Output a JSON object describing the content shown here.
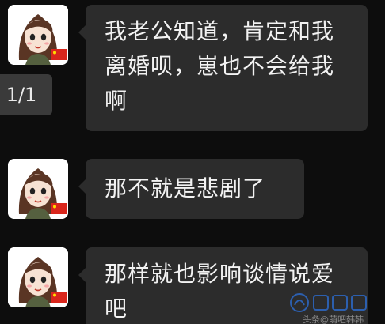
{
  "page_counter": "1/1",
  "messages": [
    {
      "sender": "contact",
      "text": "我老公知道，肯定和我离婚呗，崽也不会给我啊"
    },
    {
      "sender": "contact",
      "text": "那不就是悲剧了"
    },
    {
      "sender": "contact",
      "text": "那样就也影响谈情说爱吧"
    }
  ],
  "watermark": {
    "text": "头条@萌吧韩韩",
    "logo": "site-logo"
  },
  "colors": {
    "background": "#0d0d0d",
    "bubble": "#2c2c2c",
    "bubble_text": "#f2f2f2",
    "counter_bg": "#3a3a3a",
    "flag_red": "#d9261c"
  },
  "icons": [
    "cartoon-girl-avatar-icon",
    "china-flag-icon"
  ]
}
